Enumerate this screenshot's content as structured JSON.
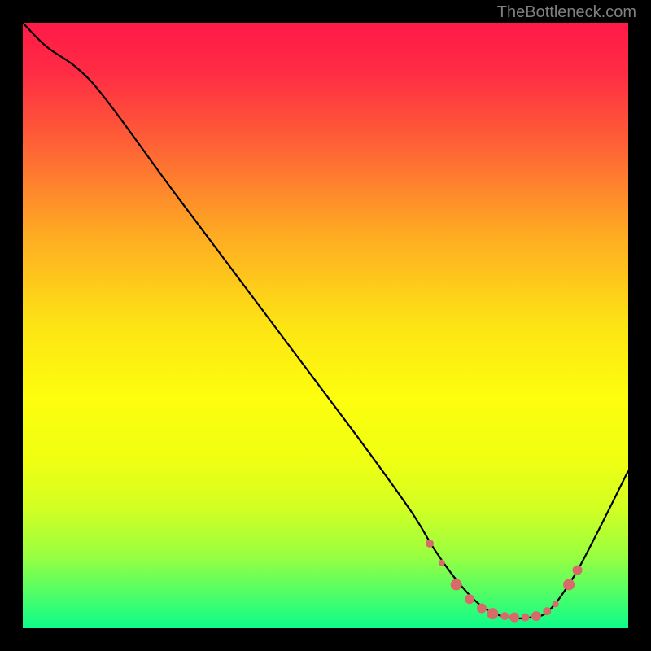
{
  "watermark": "TheBottleneck.com",
  "chart_data": {
    "type": "line",
    "title": "",
    "xlabel": "",
    "ylabel": "",
    "xlim": [
      0,
      1
    ],
    "ylim": [
      0,
      1
    ],
    "background_gradient": {
      "stops": [
        {
          "pos": 0.0,
          "color": "#ff1a48"
        },
        {
          "pos": 0.08,
          "color": "#ff2b44"
        },
        {
          "pos": 0.2,
          "color": "#fe6136"
        },
        {
          "pos": 0.35,
          "color": "#feab23"
        },
        {
          "pos": 0.5,
          "color": "#fde414"
        },
        {
          "pos": 0.62,
          "color": "#fdfe0d"
        },
        {
          "pos": 0.72,
          "color": "#f0ff12"
        },
        {
          "pos": 0.8,
          "color": "#d3ff22"
        },
        {
          "pos": 0.88,
          "color": "#9aff40"
        },
        {
          "pos": 0.94,
          "color": "#53fe65"
        },
        {
          "pos": 1.0,
          "color": "#0dfc8a"
        }
      ]
    },
    "series": [
      {
        "name": "curve",
        "type": "line",
        "color": "#000000",
        "points": [
          {
            "x": 0.0,
            "y": 1.0
          },
          {
            "x": 0.04,
            "y": 0.96
          },
          {
            "x": 0.09,
            "y": 0.925
          },
          {
            "x": 0.14,
            "y": 0.87
          },
          {
            "x": 0.25,
            "y": 0.72
          },
          {
            "x": 0.4,
            "y": 0.52
          },
          {
            "x": 0.55,
            "y": 0.32
          },
          {
            "x": 0.64,
            "y": 0.195
          },
          {
            "x": 0.68,
            "y": 0.13
          },
          {
            "x": 0.72,
            "y": 0.075
          },
          {
            "x": 0.76,
            "y": 0.035
          },
          {
            "x": 0.8,
            "y": 0.018
          },
          {
            "x": 0.84,
            "y": 0.018
          },
          {
            "x": 0.87,
            "y": 0.03
          },
          {
            "x": 0.91,
            "y": 0.085
          },
          {
            "x": 0.95,
            "y": 0.16
          },
          {
            "x": 1.0,
            "y": 0.26
          }
        ]
      },
      {
        "name": "low-markers",
        "type": "scatter",
        "color": "#d96a6a",
        "points": [
          {
            "x": 0.672,
            "y": 0.14,
            "r": 5
          },
          {
            "x": 0.692,
            "y": 0.108,
            "r": 4
          },
          {
            "x": 0.716,
            "y": 0.072,
            "r": 7
          },
          {
            "x": 0.738,
            "y": 0.048,
            "r": 6
          },
          {
            "x": 0.758,
            "y": 0.033,
            "r": 6
          },
          {
            "x": 0.776,
            "y": 0.024,
            "r": 7
          },
          {
            "x": 0.796,
            "y": 0.02,
            "r": 5
          },
          {
            "x": 0.812,
            "y": 0.018,
            "r": 6
          },
          {
            "x": 0.83,
            "y": 0.018,
            "r": 5
          },
          {
            "x": 0.848,
            "y": 0.02,
            "r": 6
          },
          {
            "x": 0.866,
            "y": 0.028,
            "r": 5
          },
          {
            "x": 0.88,
            "y": 0.04,
            "r": 4
          },
          {
            "x": 0.902,
            "y": 0.072,
            "r": 7
          },
          {
            "x": 0.916,
            "y": 0.096,
            "r": 6
          }
        ]
      }
    ]
  }
}
